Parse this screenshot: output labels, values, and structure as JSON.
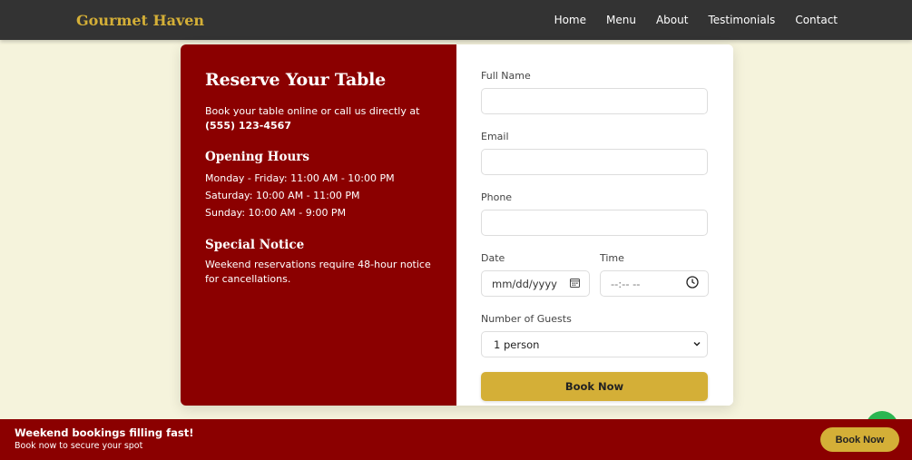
{
  "navbar": {
    "brand": "Gourmet Haven",
    "links": [
      "Home",
      "Menu",
      "About",
      "Testimonials",
      "Contact"
    ]
  },
  "info": {
    "title": "Reserve Your Table",
    "intro": "Book your table online or call us directly at",
    "phone": "(555) 123-4567",
    "hours_title": "Opening Hours",
    "hours": [
      "Monday - Friday: 11:00 AM - 10:00 PM",
      "Saturday: 10:00 AM - 11:00 PM",
      "Sunday: 10:00 AM - 9:00 PM"
    ],
    "notice_title": "Special Notice",
    "notice_text": "Weekend reservations require 48-hour notice for cancellations."
  },
  "form": {
    "name_label": "Full Name",
    "email_label": "Email",
    "phone_label": "Phone",
    "date_label": "Date",
    "date_placeholder": "mm/dd/yyyy",
    "time_label": "Time",
    "time_placeholder": "--:-- --",
    "guests_label": "Number of Guests",
    "guests_value": "1 person",
    "submit_label": "Book Now"
  },
  "banner": {
    "title": "Weekend bookings filling fast!",
    "subtitle": "Book now to secure your spot",
    "button_label": "Book Now"
  },
  "colors": {
    "accent_gold": "#d4af37",
    "primary_red": "#8b0000",
    "nav_bg": "#333333",
    "page_bg": "#f5f3dc",
    "chat_green": "#2bb551"
  },
  "icons": [
    "calendar-icon",
    "clock-icon",
    "chevron-down-icon",
    "chat-icon"
  ]
}
